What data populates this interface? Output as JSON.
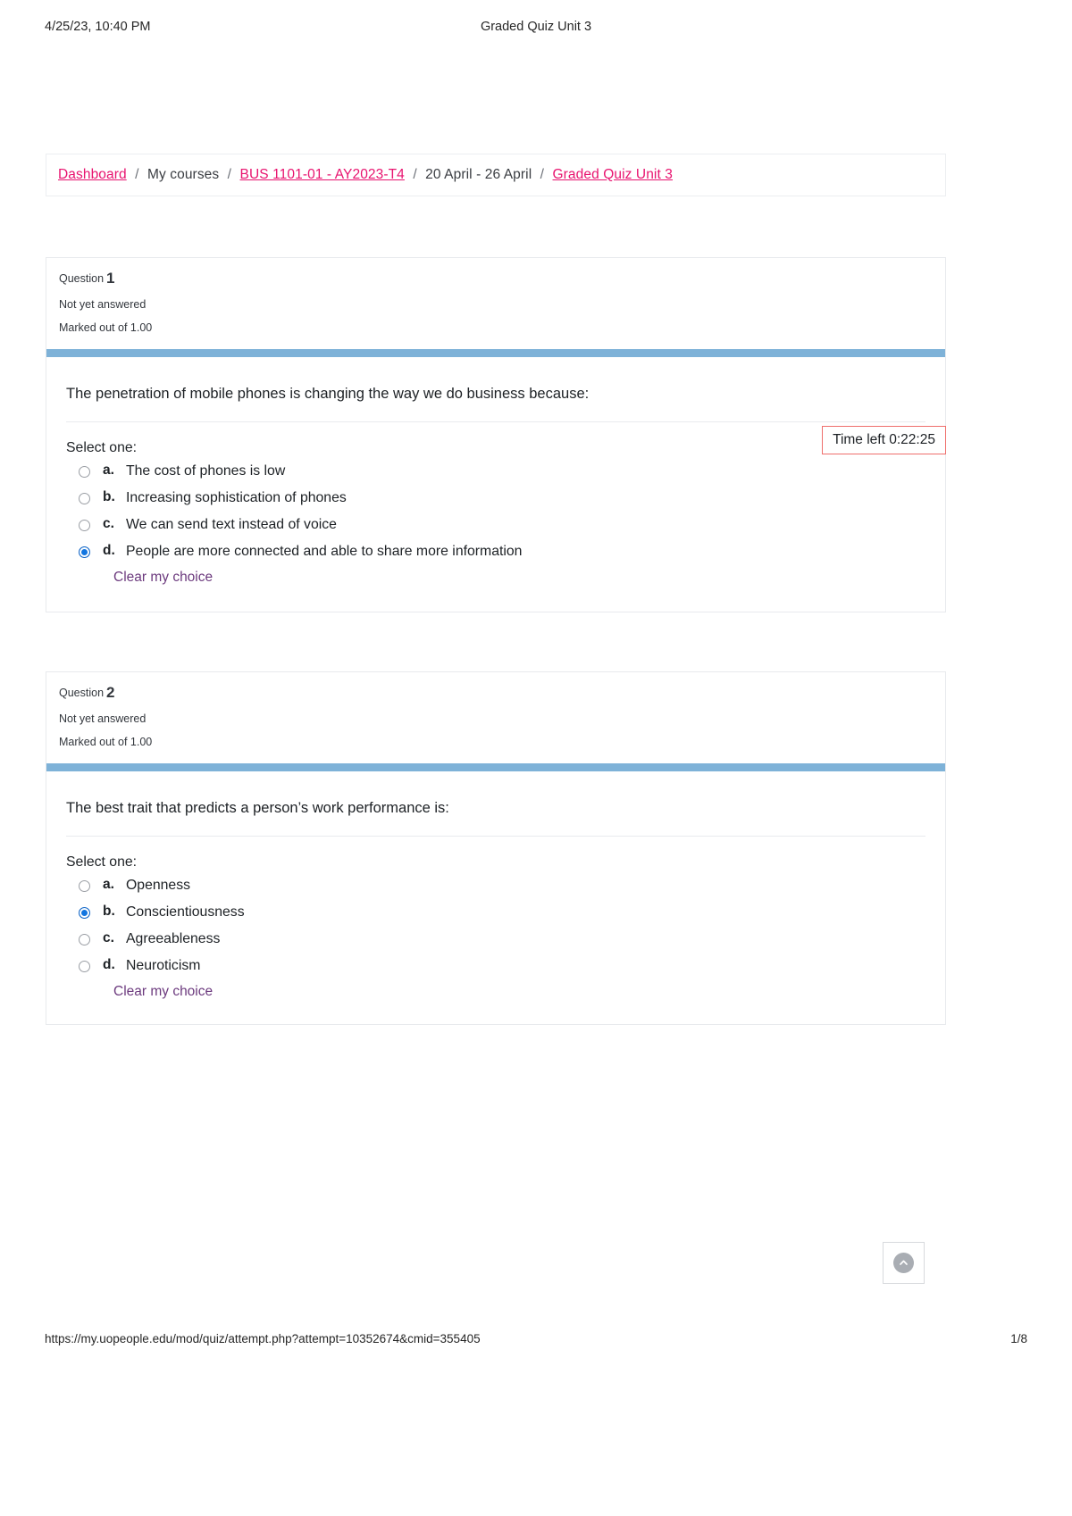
{
  "print_header": {
    "date": "4/25/23, 10:40 PM",
    "title": "Graded Quiz Unit 3"
  },
  "breadcrumb": {
    "items": [
      {
        "label": "Dashboard",
        "link": true
      },
      {
        "label": "My courses",
        "link": false
      },
      {
        "label": "BUS 1101-01 - AY2023-T4",
        "link": true
      },
      {
        "label": "20 April - 26 April",
        "link": false
      },
      {
        "label": "Graded Quiz Unit 3",
        "link": true
      }
    ],
    "separator": "/"
  },
  "timer": {
    "label": "Time left",
    "value": "0:22:25",
    "text": "Time left 0:22:25",
    "border_color": "#ef6f6c"
  },
  "questions": [
    {
      "number_label": "Question",
      "number": "1",
      "state": "Not yet answered",
      "grade": "Marked out of 1.00",
      "text": "The penetration of mobile phones is changing the way we do business because:",
      "select_prompt": "Select one:",
      "clear_choice": "Clear my choice",
      "options": [
        {
          "letter": "a.",
          "text": "The cost of phones is low",
          "checked": false
        },
        {
          "letter": "b.",
          "text": "Increasing sophistication of phones",
          "checked": false
        },
        {
          "letter": "c.",
          "text": "We can send text instead of voice",
          "checked": false
        },
        {
          "letter": "d.",
          "text": "People are more connected and able to share more information",
          "checked": true
        }
      ]
    },
    {
      "number_label": "Question",
      "number": "2",
      "state": "Not yet answered",
      "grade": "Marked out of 1.00",
      "text": "The best trait that predicts a person’s work performance is:",
      "select_prompt": "Select one:",
      "clear_choice": "Clear my choice",
      "options": [
        {
          "letter": "a.",
          "text": "Openness",
          "checked": false
        },
        {
          "letter": "b.",
          "text": "Conscientiousness",
          "checked": true
        },
        {
          "letter": "c.",
          "text": "Agreeableness",
          "checked": false
        },
        {
          "letter": "d.",
          "text": "Neuroticism",
          "checked": false
        }
      ]
    }
  ],
  "back_to_top": {
    "icon": "chevron-up-circle-icon",
    "label": ""
  },
  "print_footer": {
    "url": "https://my.uopeople.edu/mod/quiz/attempt.php?attempt=10352674&cmid=355405",
    "page": "1/8"
  },
  "colors": {
    "link_pink": "#e8136f",
    "question_bar_blue": "#7eb2d8",
    "clear_choice_purple": "#6c3a7e",
    "radio_checked_blue": "#1275e0",
    "timer_red": "#ef6f6c"
  }
}
